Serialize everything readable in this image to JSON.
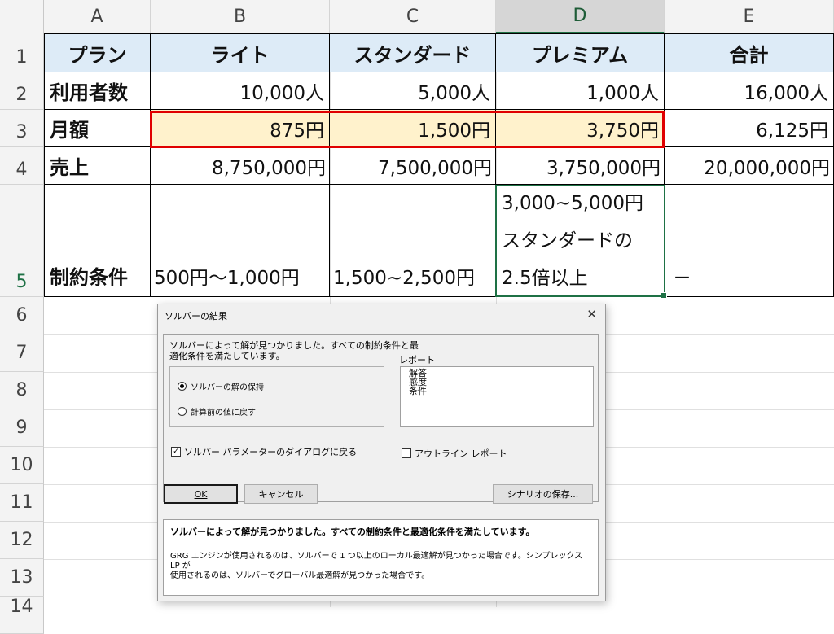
{
  "columns": [
    "A",
    "B",
    "C",
    "D",
    "E"
  ],
  "rows": [
    "1",
    "2",
    "3",
    "4",
    "5",
    "6",
    "7",
    "8",
    "9",
    "10",
    "11",
    "12",
    "13",
    "14"
  ],
  "table": {
    "header": [
      "プラン",
      "ライト",
      "スタンダード",
      "プレミアム",
      "合計"
    ],
    "users": [
      "利用者数",
      "10,000人",
      "5,000人",
      "1,000人",
      "16,000人"
    ],
    "monthly": [
      "月額",
      "875円",
      "1,500円",
      "3,750円",
      "6,125円"
    ],
    "sales": [
      "売上",
      "8,750,000円",
      "7,500,000円",
      "3,750,000円",
      "20,000,000円"
    ],
    "constraints": {
      "label": "制約条件",
      "lite": "500円～1,000円",
      "standard": "1,500~2,500円",
      "premium": [
        "3,000~5,000円",
        "スタンダードの",
        "2.5倍以上"
      ],
      "total": "－"
    }
  },
  "colors": {
    "header_fill": "#ddebf7",
    "highlight_fill": "#fff2cc",
    "red_border": "#e00000",
    "selection_green": "#1e7145"
  },
  "dialog": {
    "title": "ソルバーの結果",
    "message_line1": "ソルバーによって解が見つかりました。すべての制約条件と最",
    "message_line2": "適化条件を満たしています。",
    "radio_keep": "ソルバーの解の保持",
    "radio_restore": "計算前の値に戻す",
    "report_label": "レポート",
    "reports": [
      "解答",
      "感度",
      "条件"
    ],
    "return_dialog_label": "ソルバー パラメーターのダイアログに戻る",
    "outline_report_label": "アウトライン レポート",
    "ok_label": "OK",
    "cancel_label": "キャンセル",
    "save_scenario_label": "シナリオの保存...",
    "desc_bold": "ソルバーによって解が見つかりました。すべての制約条件と最適化条件を満たしています。",
    "desc_line1": "GRG エンジンが使用されるのは、ソルバーで 1 つ以上のローカル最適解が見つかった場合です。シンプレックス LP が",
    "desc_line2": "使用されるのは、ソルバーでグローバル最適解が見つかった場合です。"
  }
}
